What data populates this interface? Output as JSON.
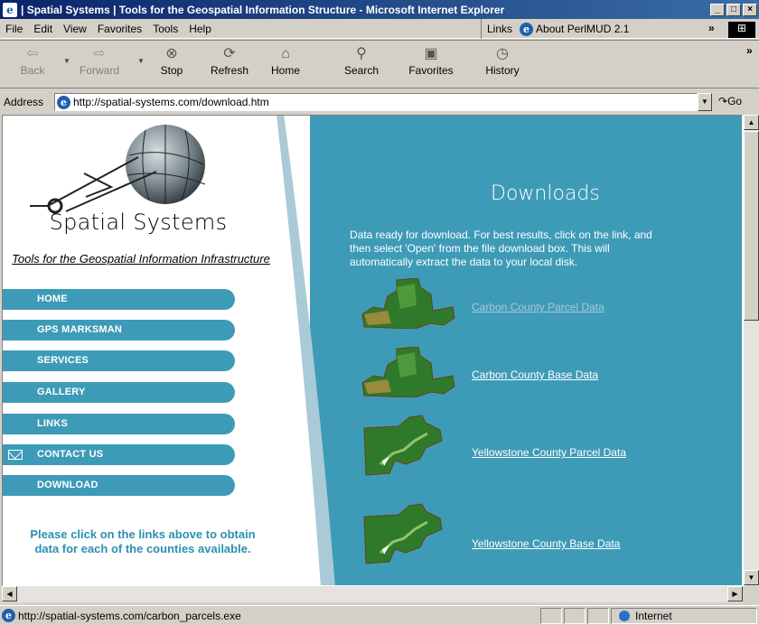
{
  "window": {
    "title": "| Spatial Systems | Tools for the Geospatial Information Structure - Microsoft Internet Explorer"
  },
  "menu": [
    "File",
    "Edit",
    "View",
    "Favorites",
    "Tools",
    "Help"
  ],
  "links_bar": {
    "label": "Links",
    "item": "About PerlMUD 2.1"
  },
  "toolbar": {
    "back": "Back",
    "forward": "Forward",
    "stop": "Stop",
    "refresh": "Refresh",
    "home": "Home",
    "search": "Search",
    "favorites": "Favorites",
    "history": "History"
  },
  "address": {
    "label": "Address",
    "url": "http://spatial-systems.com/download.htm",
    "go": "Go"
  },
  "site": {
    "brand": "Spatial Systems",
    "tagline": "Tools for the Geospatial Information Infrastructure",
    "nav": [
      "HOME",
      "GPS MARKSMAN",
      "SERVICES",
      "GALLERY",
      "LINKS",
      "CONTACT US",
      "DOWNLOAD"
    ],
    "note": "Please click on the links above to obtain data for each of the counties available."
  },
  "content": {
    "heading": "Downloads",
    "intro": "Data ready for download. For best results, click on the link, and then select 'Open' from the file download box. This will automatically extract the data to your local disk.",
    "downloads": [
      "Carbon County Parcel Data",
      "Carbon County Base Data",
      "Yellowstone County Parcel Data",
      "Yellowstone County Base Data"
    ]
  },
  "status": {
    "text": "http://spatial-systems.com/carbon_parcels.exe",
    "zone": "Internet"
  },
  "colors": {
    "accent": "#3e9bb7",
    "title_bar": "#0a246a"
  }
}
